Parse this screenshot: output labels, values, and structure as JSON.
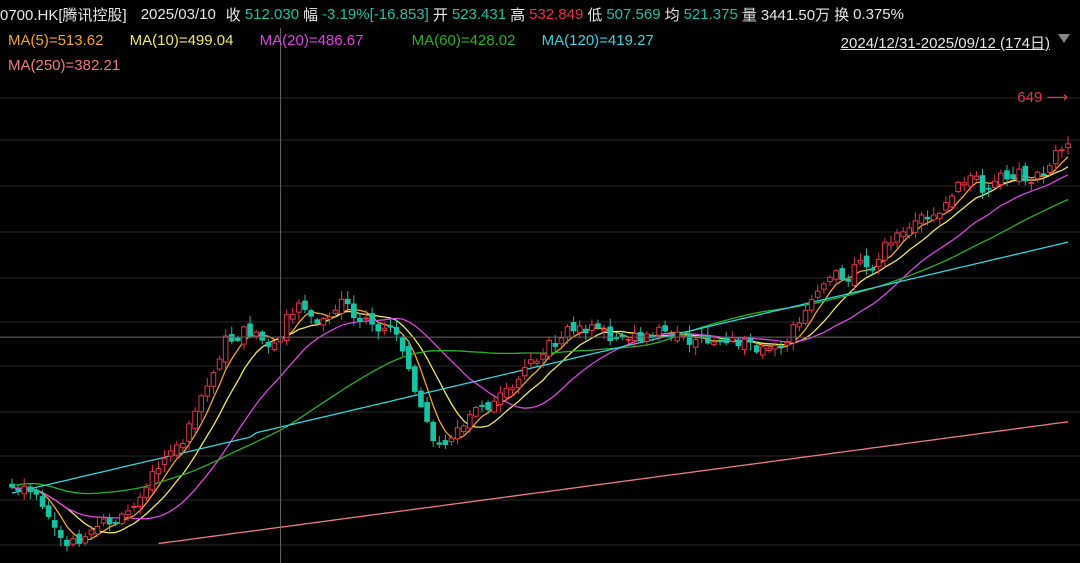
{
  "header": {
    "symbol": "0700.HK[腾讯控股]",
    "date": "2025/03/10",
    "close_label": "收",
    "close_value": "512.030",
    "change_label": "幅",
    "change_value": "-3.19%[-16.853]",
    "open_label": "开",
    "open_value": "523.431",
    "high_label": "高",
    "high_value": "532.849",
    "low_label": "低",
    "low_value": "507.569",
    "avg_label": "均",
    "avg_value": "521.375",
    "volume_label": "量",
    "volume_value": "3441.50万",
    "turnover_label": "换",
    "turnover_value": "0.375%"
  },
  "ma_legend": [
    {
      "text": "MA(5)=513.62",
      "color": "#f5a623"
    },
    {
      "text": "MA(10)=499.04",
      "color": "#f2e85c"
    },
    {
      "text": "MA(20)=486.67",
      "color": "#e040e6"
    },
    {
      "text": "MA(60)=428.02",
      "color": "#22b422"
    },
    {
      "text": "MA(120)=419.27",
      "color": "#31d6e0"
    },
    {
      "text": "MA(250)=382.21",
      "color": "#f07a78"
    }
  ],
  "range_label": "2024/12/31-2025/09/12 (174日)",
  "colors": {
    "up": "#e8324b",
    "down": "#19c2a4",
    "grid": "#2a2a2a",
    "crosshair": "#666666"
  },
  "chart_data": {
    "type": "candlestick",
    "price_marker": "649",
    "crosshair_date": "2025/03/10",
    "crosshair_price": 512.03,
    "ylim": [
      370,
      665
    ],
    "grid": true,
    "series_close": [
      411.0,
      409.0,
      411.6,
      407.9,
      406.2,
      398.0,
      391.2,
      384.0,
      377.1,
      371.6,
      376.3,
      373.1,
      377.6,
      382.1,
      384.5,
      389.5,
      386.2,
      386.7,
      392.9,
      395.0,
      398.0,
      404.2,
      410.6,
      421.4,
      423.5,
      430.4,
      435.4,
      439.3,
      440.4,
      453.6,
      462.1,
      472.5,
      479.1,
      488.1,
      497.3,
      512.8,
      509.3,
      509.8,
      518.9,
      512.8,
      515.4,
      510.0,
      505.8,
      508.0,
      512.1,
      527.1,
      527.4,
      535.0,
      530.7,
      526.2,
      521.4,
      524.5,
      525.6,
      530.2,
      537.5,
      534.6,
      525.2,
      522.6,
      524.9,
      520.8,
      516.2,
      518.0,
      518.8,
      514.1,
      502.7,
      490.9,
      475.5,
      465.2,
      455.3,
      442.4,
      439.9,
      439.7,
      444.1,
      450.9,
      452.3,
      459.8,
      464.6,
      465.5,
      463.3,
      468.9,
      474.4,
      477.6,
      478.0,
      483.7,
      491.5,
      496.8,
      495.8,
      500.5,
      509.8,
      505.8,
      511.5,
      519.1,
      516.3,
      519.6,
      515.1,
      520.3,
      518.3,
      517.3,
      509.7,
      511.0,
      512.0,
      510.6,
      514.4,
      509.4,
      514.2,
      512.9,
      518.7,
      516.2,
      512.5,
      515.4,
      513.2,
      507.2,
      510.3,
      512.7,
      508.1,
      508.8,
      508.9,
      508.3,
      511.6,
      506.3,
      510.6,
      508.7,
      502.1,
      505.4,
      504.6,
      506.4,
      505.6,
      508.4,
      520.4,
      521.5,
      530.2,
      537.2,
      543.0,
      547.9,
      552.3,
      556.8,
      550.9,
      549.7,
      560.8,
      563.8,
      559.6,
      557.1,
      564.4,
      576.0,
      575.4,
      582.1,
      582.9,
      585.6,
      590.3,
      594.3,
      591.6,
      594.3,
      595.4,
      602.6,
      607.1,
      616.3,
      616.0,
      620.7,
      620.4,
      609.6,
      611.8,
      617.0,
      622.5,
      618.6,
      618.9,
      625.2,
      617.3,
      616.1,
      623.1,
      621.4,
      627.5,
      637.6,
      638.2,
      642.2
    ],
    "ma_series": [
      {
        "name": "MA(5)",
        "key": "ma5",
        "color": "#f5a623",
        "last": 513.62
      },
      {
        "name": "MA(10)",
        "key": "ma10",
        "color": "#f2e85c",
        "last": 499.04
      },
      {
        "name": "MA(20)",
        "key": "ma20",
        "color": "#e040e6",
        "last": 486.67
      },
      {
        "name": "MA(60)",
        "key": "ma60",
        "color": "#22b422",
        "last": 428.02
      },
      {
        "name": "MA(120)",
        "key": "ma120",
        "color": "#31d6e0",
        "last": 419.27
      },
      {
        "name": "MA(250)",
        "key": "ma250",
        "color": "#f07a78",
        "last": 382.21
      }
    ]
  }
}
